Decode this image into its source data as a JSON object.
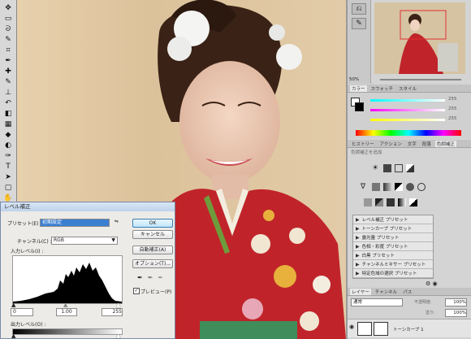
{
  "toolbar": {
    "tools": [
      "move-icon",
      "marquee-icon",
      "lasso-icon",
      "quick-select-icon",
      "crop-icon",
      "eyedropper-icon",
      "healing-icon",
      "brush-icon",
      "clone-stamp-icon",
      "history-brush-icon",
      "eraser-icon",
      "gradient-icon",
      "blur-icon",
      "dodge-icon",
      "pen-icon",
      "type-icon",
      "path-select-icon",
      "shape-icon",
      "hand-icon",
      "zoom-icon"
    ]
  },
  "panels": {
    "navigator": {
      "zoom": "50%"
    },
    "color_tabs": [
      "カラー",
      "スウォッチ",
      "スタイル"
    ],
    "color_values": [
      "255",
      "255",
      "255"
    ],
    "adjust_tabs": [
      "ヒストリー",
      "アクション",
      "文字",
      "段落",
      "色調補正"
    ],
    "adjust_hint": "色調補正を追加",
    "presets": [
      "レベル補正 プリセット",
      "トーンカーブ プリセット",
      "露光量 プリセット",
      "色相・彩度 プリセット",
      "白黒 プリセット",
      "チャンネルミキサー プリセット",
      "特定色域の選択 プリセット"
    ],
    "layer_tabs": [
      "レイヤー",
      "チャンネル",
      "パス"
    ],
    "blend_mode": "通常",
    "opacity_label": "不透明度:",
    "opacity_value": "100%",
    "fill_label": "塗り:",
    "fill_value": "100%",
    "layer_name": "トーンカーブ 1"
  },
  "dialog": {
    "title": "レベル補正",
    "preset_label": "プリセット(E) :",
    "preset_value": "初期設定",
    "channel_label": "チャンネル(C) :",
    "channel_value": "RGB",
    "input_label": "入力レベル(I) :",
    "input_values": [
      "0",
      "1.00",
      "255"
    ],
    "output_label": "出力レベル(O) :",
    "ok": "OK",
    "cancel": "キャンセル",
    "auto": "自動補正(A)",
    "options": "オプション(T)...",
    "preview": "プレビュー(P)"
  },
  "colors": {
    "accent_blue": "#3b7fd1",
    "kimono_red": "#c0242a",
    "panel_bg": "#d4d4d4"
  }
}
